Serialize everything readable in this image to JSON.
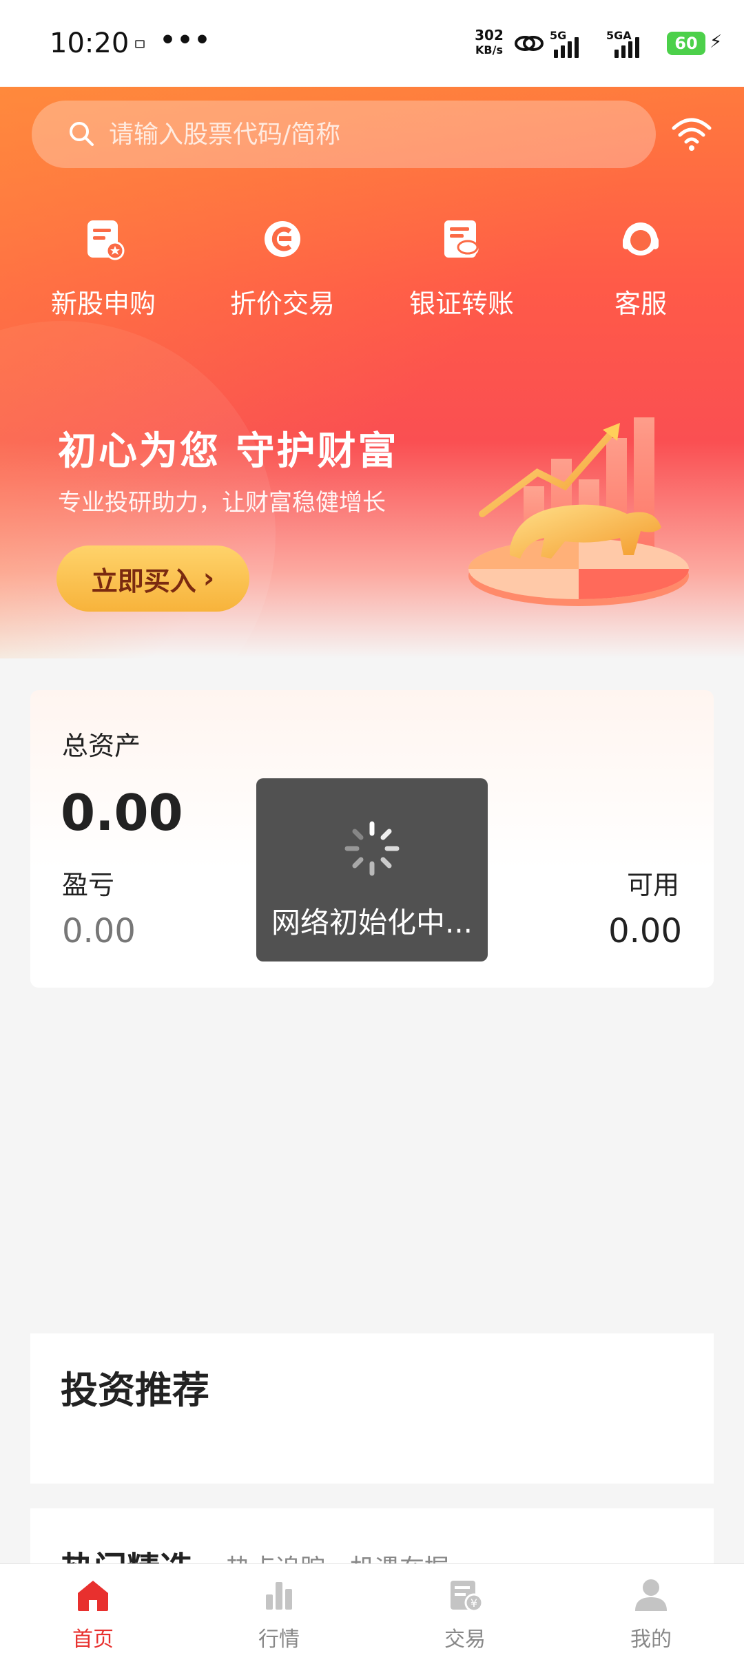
{
  "status_bar": {
    "time": "10:20",
    "dots": "•••",
    "net_speed_value": "302",
    "net_speed_unit": "KB/s",
    "signal1": "5G",
    "signal2": "5GA",
    "battery": "60"
  },
  "search": {
    "placeholder": "请输入股票代码/简称"
  },
  "quick_actions": [
    {
      "label": "新股申购",
      "icon": "ipo-icon"
    },
    {
      "label": "折价交易",
      "icon": "discount-trade-icon"
    },
    {
      "label": "银证转账",
      "icon": "bank-transfer-icon"
    },
    {
      "label": "客服",
      "icon": "headset-icon"
    }
  ],
  "banner": {
    "title": "初心为您 守护财富",
    "subtitle": "专业投研助力，让财富稳健增长",
    "button": "立即买入",
    "button_chevron": "›"
  },
  "assets": {
    "total_label": "总资产",
    "total_value": "0.00",
    "pl_label": "盈亏",
    "pl_value": "0.00",
    "available_label": "可用",
    "available_value": "0.00"
  },
  "toast": {
    "text": "网络初始化中..."
  },
  "recommend": {
    "title": "投资推荐"
  },
  "hot": {
    "title": "热门精选",
    "subtitle": "热点追踪，机遇在握"
  },
  "tabs": [
    {
      "label": "首页",
      "icon": "home-icon",
      "active": true
    },
    {
      "label": "行情",
      "icon": "market-icon",
      "active": false
    },
    {
      "label": "交易",
      "icon": "trade-icon",
      "active": false
    },
    {
      "label": "我的",
      "icon": "profile-icon",
      "active": false
    }
  ],
  "colors": {
    "accent": "#e8302e",
    "hero_start": "#ff7a3d",
    "hero_end": "#fa4f52",
    "button": "#f7b33b"
  }
}
